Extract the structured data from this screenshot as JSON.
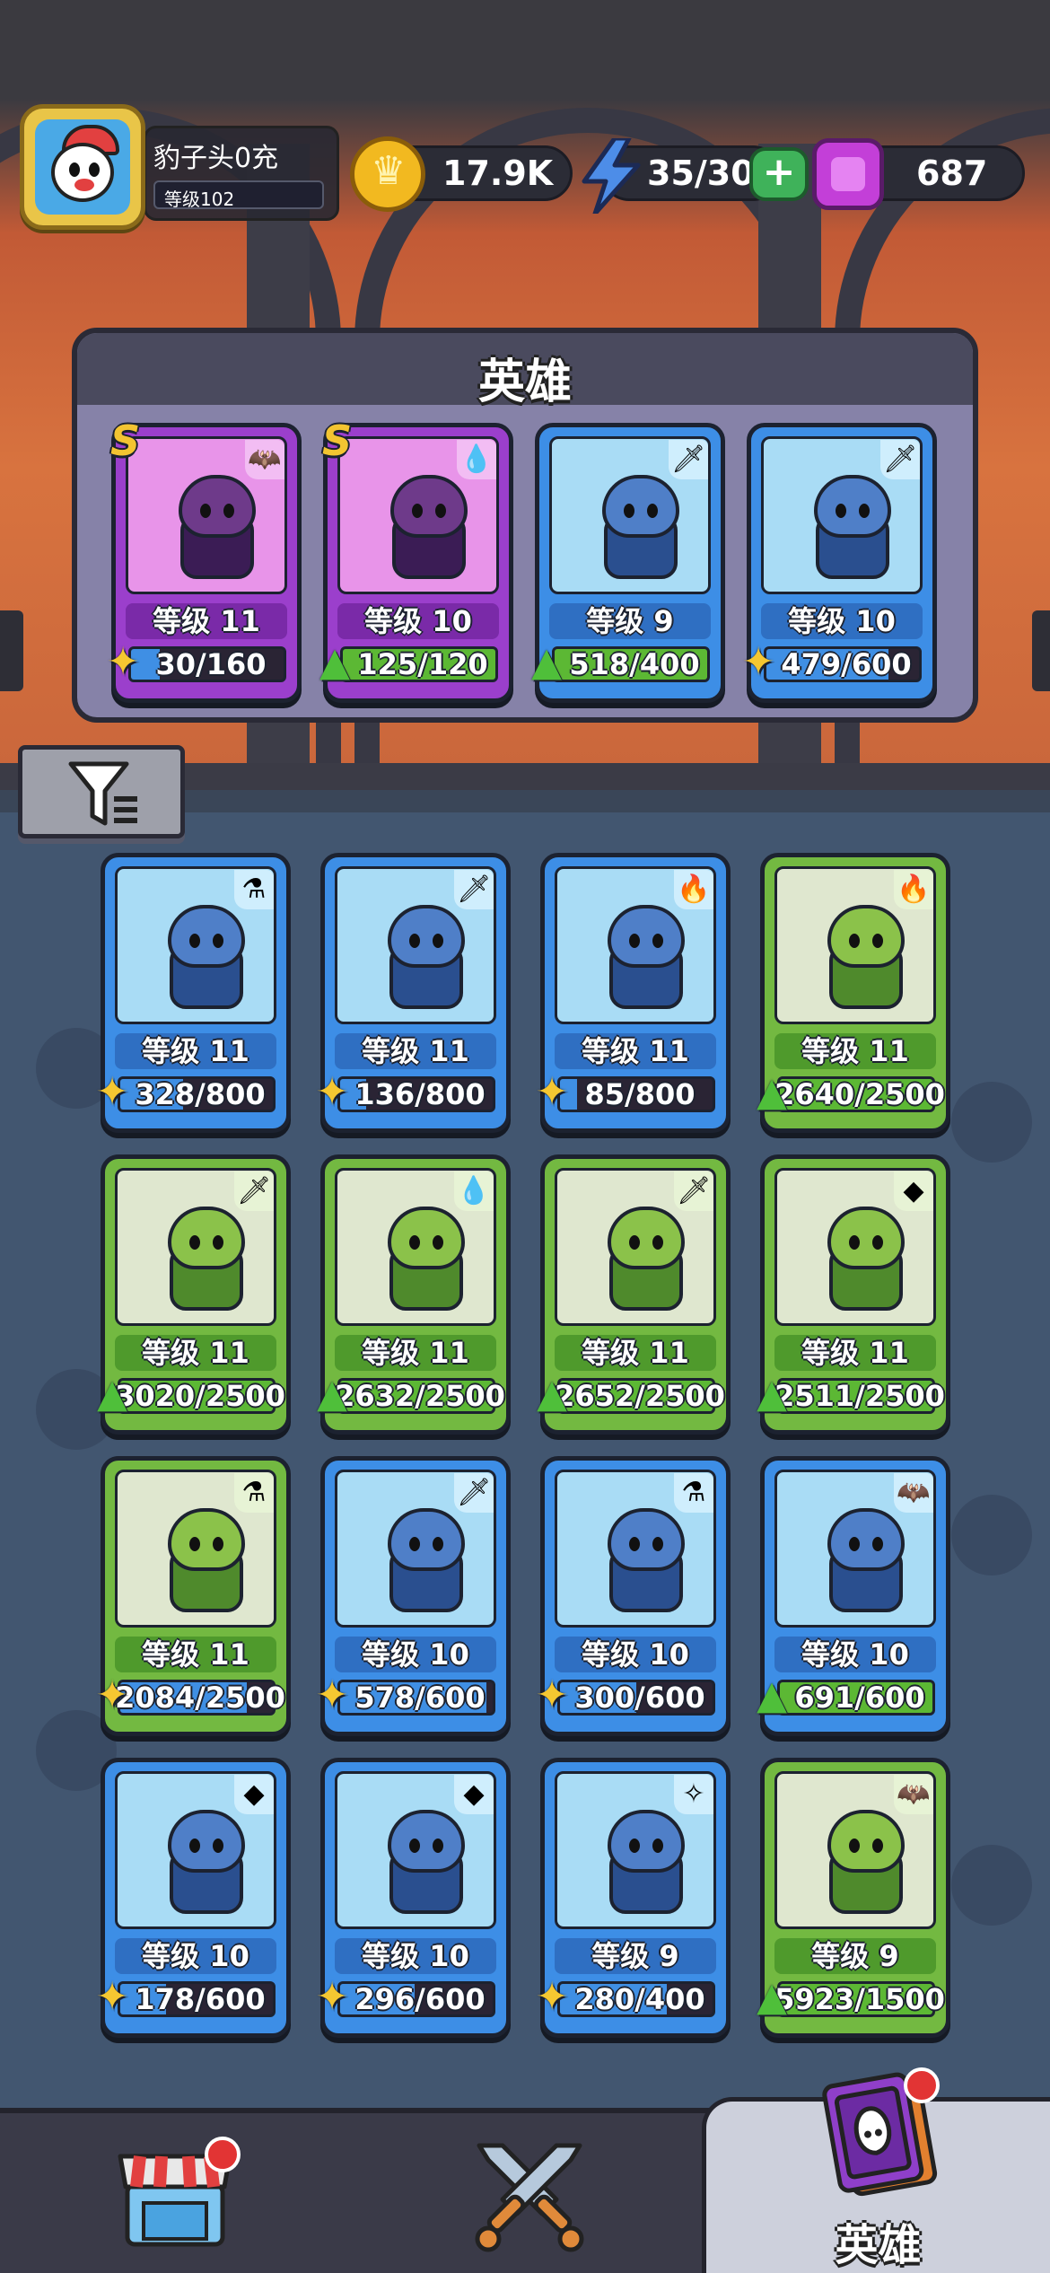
{
  "player": {
    "name": "豹子头0充",
    "level": "等级102"
  },
  "resources": {
    "gold": "17.9K",
    "energy": "35/30",
    "gems": "687"
  },
  "hero_panel": {
    "title": "英雄"
  },
  "featured_heroes": [
    {
      "rank": "S",
      "level": "等级 11",
      "progress": "30/160",
      "fraction": 0.19,
      "color": "purple",
      "element": "bat-icon",
      "badge": "puzzle"
    },
    {
      "rank": "S",
      "level": "等级 10",
      "progress": "125/120",
      "fraction": 1.0,
      "color": "purple",
      "element": "water-drop-icon",
      "badge": "arrow"
    },
    {
      "rank": "",
      "level": "等级 9",
      "progress": "518/400",
      "fraction": 1.0,
      "color": "blue",
      "element": "sword-icon",
      "badge": "arrow"
    },
    {
      "rank": "",
      "level": "等级 10",
      "progress": "479/600",
      "fraction": 0.8,
      "color": "blue",
      "element": "sword-icon",
      "badge": "puzzle"
    }
  ],
  "hero_list": [
    {
      "level": "等级 11",
      "progress": "328/800",
      "fraction": 0.41,
      "color": "blue",
      "element": "potion-icon",
      "badge": "puzzle"
    },
    {
      "level": "等级 11",
      "progress": "136/800",
      "fraction": 0.17,
      "color": "blue",
      "element": "sword-icon",
      "badge": "puzzle"
    },
    {
      "level": "等级 11",
      "progress": "85/800",
      "fraction": 0.11,
      "color": "blue",
      "element": "fire-icon",
      "badge": "puzzle"
    },
    {
      "level": "等级 11",
      "progress": "2640/2500",
      "fraction": 1.0,
      "color": "green",
      "element": "fire-icon",
      "badge": "arrow"
    },
    {
      "level": "等级 11",
      "progress": "3020/2500",
      "fraction": 1.0,
      "color": "green",
      "element": "sword-icon",
      "badge": "arrow"
    },
    {
      "level": "等级 11",
      "progress": "2632/2500",
      "fraction": 1.0,
      "color": "green",
      "element": "water-drop-icon",
      "badge": "arrow"
    },
    {
      "level": "等级 11",
      "progress": "2652/2500",
      "fraction": 1.0,
      "color": "green",
      "element": "sword-icon",
      "badge": "arrow"
    },
    {
      "level": "等级 11",
      "progress": "2511/2500",
      "fraction": 1.0,
      "color": "green",
      "element": "rock-icon",
      "badge": "arrow"
    },
    {
      "level": "等级 11",
      "progress": "2084/2500",
      "fraction": 0.83,
      "color": "green",
      "element": "potion-icon",
      "badge": "puzzle"
    },
    {
      "level": "等级 10",
      "progress": "578/600",
      "fraction": 0.96,
      "color": "blue",
      "element": "sword-icon",
      "badge": "puzzle"
    },
    {
      "level": "等级 10",
      "progress": "300/600",
      "fraction": 0.5,
      "color": "blue",
      "element": "potion-icon",
      "badge": "puzzle"
    },
    {
      "level": "等级 10",
      "progress": "691/600",
      "fraction": 1.0,
      "color": "blue",
      "element": "bat-icon",
      "badge": "arrow"
    },
    {
      "level": "等级 10",
      "progress": "178/600",
      "fraction": 0.3,
      "color": "blue",
      "element": "rock-icon",
      "badge": "puzzle"
    },
    {
      "level": "等级 10",
      "progress": "296/600",
      "fraction": 0.49,
      "color": "blue",
      "element": "rock-icon",
      "badge": "puzzle"
    },
    {
      "level": "等级 9",
      "progress": "280/400",
      "fraction": 0.7,
      "color": "blue",
      "element": "halo-wings-icon",
      "badge": "puzzle"
    },
    {
      "level": "等级 9",
      "progress": "5923/1500",
      "fraction": 1.0,
      "color": "green",
      "element": "bat-icon",
      "badge": "arrow"
    }
  ],
  "bottom_nav": {
    "heroes_label": "英雄"
  },
  "colors": {
    "blue_card": "#3d8ee6",
    "green_card": "#73b941",
    "purple_card": "#9b3fcc",
    "rank_s": "#f3c431"
  }
}
